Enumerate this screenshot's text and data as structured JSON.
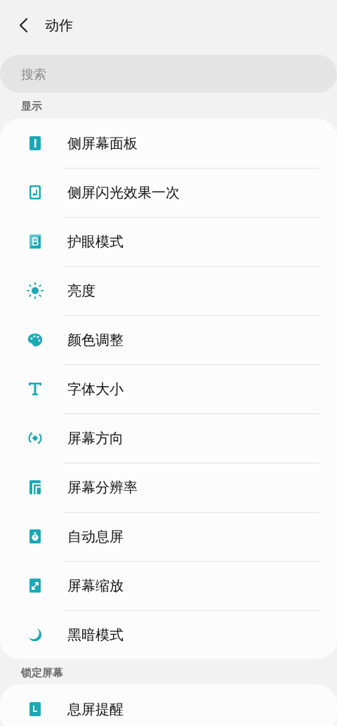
{
  "header": {
    "title": "动作"
  },
  "search": {
    "placeholder": "搜索"
  },
  "sections": [
    {
      "title": "显示",
      "items": [
        {
          "label": "侧屏幕面板"
        },
        {
          "label": "侧屏闪光效果一次"
        },
        {
          "label": "护眼模式"
        },
        {
          "label": "亮度"
        },
        {
          "label": "颜色调整"
        },
        {
          "label": "字体大小"
        },
        {
          "label": "屏幕方向"
        },
        {
          "label": "屏幕分辨率"
        },
        {
          "label": "自动息屏"
        },
        {
          "label": "屏幕缩放"
        },
        {
          "label": "黑暗模式"
        }
      ]
    },
    {
      "title": "锁定屏幕",
      "items": [
        {
          "label": "息屏提醒"
        }
      ]
    }
  ]
}
